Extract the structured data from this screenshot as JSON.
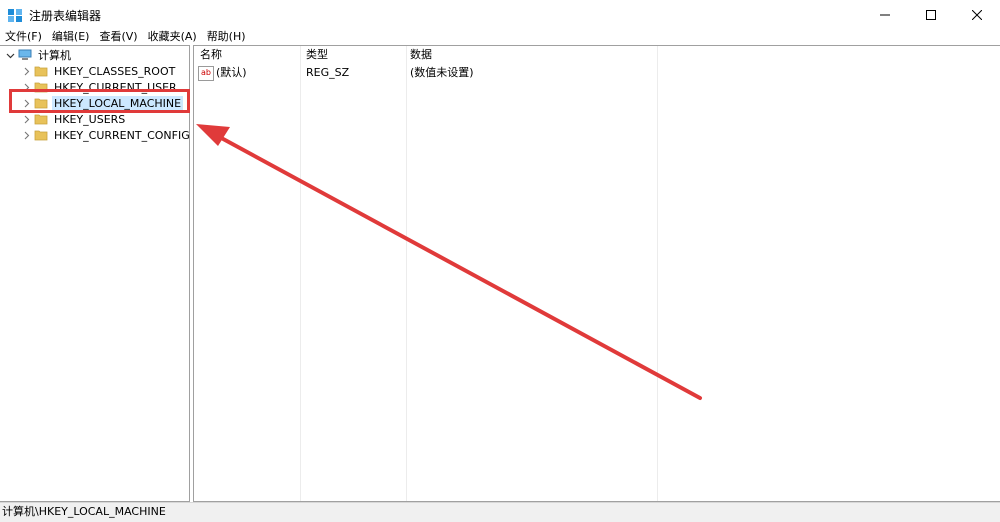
{
  "window": {
    "title": "注册表编辑器",
    "minimize_glyph": "—",
    "maximize_glyph": "☐",
    "close_glyph": "✕"
  },
  "menu": [
    "文件(F)",
    "编辑(E)",
    "查看(V)",
    "收藏夹(A)",
    "帮助(H)"
  ],
  "tree": {
    "root": "计算机",
    "items": [
      {
        "label": "HKEY_CLASSES_ROOT",
        "selected": false
      },
      {
        "label": "HKEY_CURRENT_USER",
        "selected": false
      },
      {
        "label": "HKEY_LOCAL_MACHINE",
        "selected": true
      },
      {
        "label": "HKEY_USERS",
        "selected": false
      },
      {
        "label": "HKEY_CURRENT_CONFIG",
        "selected": false
      }
    ]
  },
  "list": {
    "columns": [
      "名称",
      "类型",
      "数据"
    ],
    "rows": [
      {
        "icon": "ab",
        "name": "(默认)",
        "type": "REG_SZ",
        "data": "(数值未设置)"
      }
    ]
  },
  "status": {
    "path": "计算机\\HKEY_LOCAL_MACHINE"
  },
  "colors": {
    "annotation": "#e03a3a",
    "selection": "#cce8ff",
    "folder": "#e8c25a"
  }
}
